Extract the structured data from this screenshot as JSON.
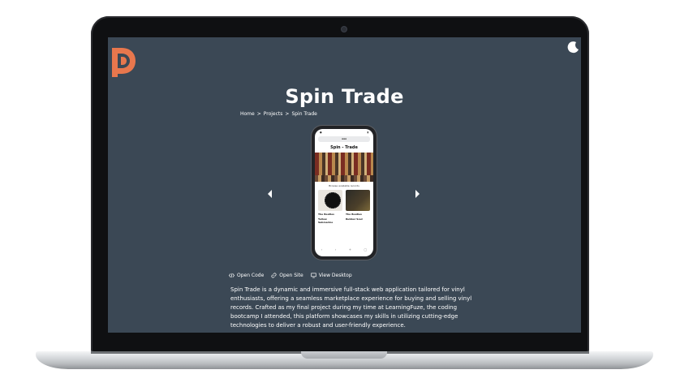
{
  "page": {
    "title": "Spin Trade",
    "breadcrumb": [
      "Home",
      ">",
      "Projects",
      ">",
      "Spin Trade"
    ],
    "links": {
      "open_code": "Open Code",
      "open_site": "Open Site",
      "view_desktop": "View Desktop"
    },
    "description": "Spin Trade is a dynamic and immersive full-stack web application tailored for vinyl enthusiasts, offering a seamless marketplace experience for buying and selling vinyl records. Crafted as my final project during my time at LearningFuze, the coding bootcamp I attended, this platform showcases my skills in utilizing cutting-edge technologies to deliver a robust and user-friendly experience."
  },
  "phone": {
    "app_title": "Spin - Trade",
    "browse_label": "Browse available records",
    "cards": [
      {
        "artist": "The Beatles",
        "album": "Yellow Submarine"
      },
      {
        "artist": "The Beatles",
        "album": "Rubber Soul"
      }
    ]
  },
  "colors": {
    "screen_bg": "#3b4855",
    "logo": "#e8774d",
    "text": "#ffffff"
  },
  "icons": {
    "logo": "dp-logo-icon",
    "theme": "moon-icon",
    "prev": "chevron-left-icon",
    "next": "chevron-right-icon",
    "code": "code-icon",
    "site": "link-icon",
    "desktop": "monitor-icon"
  }
}
